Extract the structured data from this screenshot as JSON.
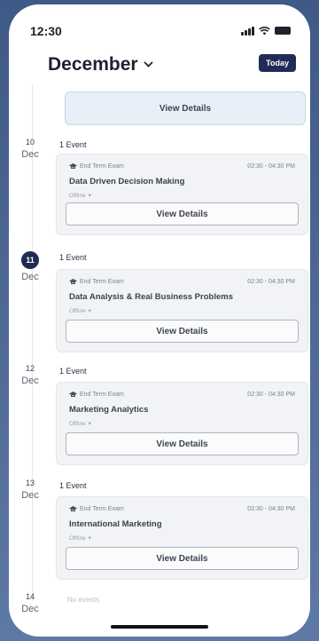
{
  "status_bar": {
    "time": "12:30"
  },
  "header": {
    "month": "December",
    "today_label": "Today"
  },
  "top_card": {
    "view_label": "View Details"
  },
  "days": [
    {
      "day": "10",
      "month": "Dec",
      "count": "1 Event",
      "event": {
        "type": "End Term Exam",
        "time": "02:30 - 04:30 PM",
        "title": "Data Driven Decision Making",
        "mode": "Offline",
        "view_label": "View Details"
      }
    },
    {
      "day": "11",
      "month": "Dec",
      "count": "1 Event",
      "event": {
        "type": "End Term Exam",
        "time": "02:30 - 04:30 PM",
        "title": "Data Analysis & Real Business Problems",
        "mode": "Offline",
        "view_label": "View Details"
      }
    },
    {
      "day": "12",
      "month": "Dec",
      "count": "1 Event",
      "event": {
        "type": "End Term Exam",
        "time": "02:30 - 04:30 PM",
        "title": "Marketing Analytics",
        "mode": "Offline",
        "view_label": "View Details"
      }
    },
    {
      "day": "13",
      "month": "Dec",
      "count": "1 Event",
      "event": {
        "type": "End Term Exam",
        "time": "02:30 - 04:30 PM",
        "title": "International Marketing",
        "mode": "Offline",
        "view_label": "View Details"
      }
    },
    {
      "day": "14",
      "month": "Dec",
      "empty": "No events"
    }
  ],
  "colors": {
    "accent": "#202c55",
    "today_circle": "#1f2b50",
    "background": "#4a6592"
  }
}
